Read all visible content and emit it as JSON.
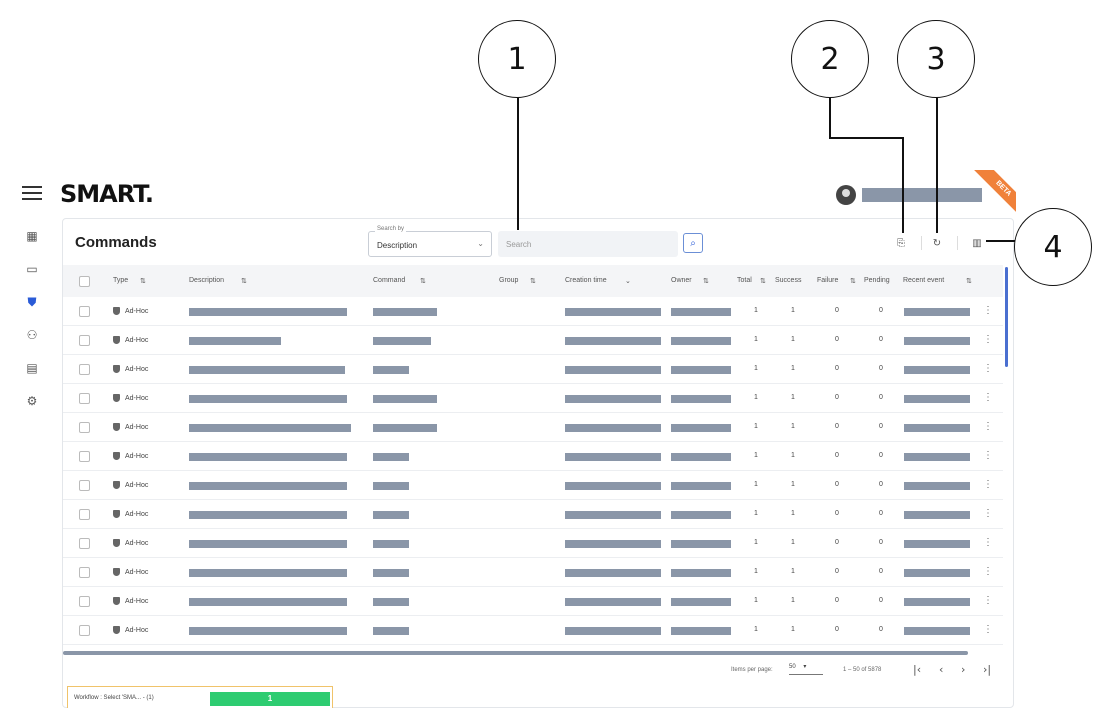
{
  "callouts": [
    "1",
    "2",
    "3",
    "4"
  ],
  "app": {
    "logo": "SMART.",
    "badge": "BETA"
  },
  "page": {
    "title": "Commands"
  },
  "search": {
    "by_label": "Search by",
    "by_value": "Description",
    "placeholder": "Search"
  },
  "sidebar": {
    "items": [
      "dashboard-icon",
      "devices-icon",
      "commands-icon",
      "users-icon",
      "reports-icon",
      "settings-icon"
    ]
  },
  "table": {
    "columns": [
      "Type",
      "Description",
      "Command",
      "Group",
      "Creation time",
      "Owner",
      "Total",
      "Success",
      "Failure",
      "Pending",
      "Recent event"
    ],
    "rows": [
      {
        "type": "Ad-Hoc",
        "total": "1",
        "success": "1",
        "failure": "0",
        "pending": "0"
      },
      {
        "type": "Ad-Hoc",
        "total": "1",
        "success": "1",
        "failure": "0",
        "pending": "0"
      },
      {
        "type": "Ad-Hoc",
        "total": "1",
        "success": "1",
        "failure": "0",
        "pending": "0"
      },
      {
        "type": "Ad-Hoc",
        "total": "1",
        "success": "1",
        "failure": "0",
        "pending": "0"
      },
      {
        "type": "Ad-Hoc",
        "total": "1",
        "success": "1",
        "failure": "0",
        "pending": "0"
      },
      {
        "type": "Ad-Hoc",
        "total": "1",
        "success": "1",
        "failure": "0",
        "pending": "0"
      },
      {
        "type": "Ad-Hoc",
        "total": "1",
        "success": "1",
        "failure": "0",
        "pending": "0"
      },
      {
        "type": "Ad-Hoc",
        "total": "1",
        "success": "1",
        "failure": "0",
        "pending": "0"
      },
      {
        "type": "Ad-Hoc",
        "total": "1",
        "success": "1",
        "failure": "0",
        "pending": "0"
      },
      {
        "type": "Ad-Hoc",
        "total": "1",
        "success": "1",
        "failure": "0",
        "pending": "0"
      },
      {
        "type": "Ad-Hoc",
        "total": "1",
        "success": "1",
        "failure": "0",
        "pending": "0"
      },
      {
        "type": "Ad-Hoc",
        "total": "1",
        "success": "1",
        "failure": "0",
        "pending": "0"
      }
    ]
  },
  "pagination": {
    "items_per_page_label": "Items per page:",
    "items_per_page": "50",
    "range": "1 – 50 of 5878"
  },
  "workflow": {
    "label": "Workflow : Select 'SMA... - (1)",
    "progress": "1"
  },
  "colors": {
    "accent": "#2a5bd7",
    "redacted": "#8a96a8",
    "beta": "#f0813a",
    "progress": "#2ecc71"
  }
}
